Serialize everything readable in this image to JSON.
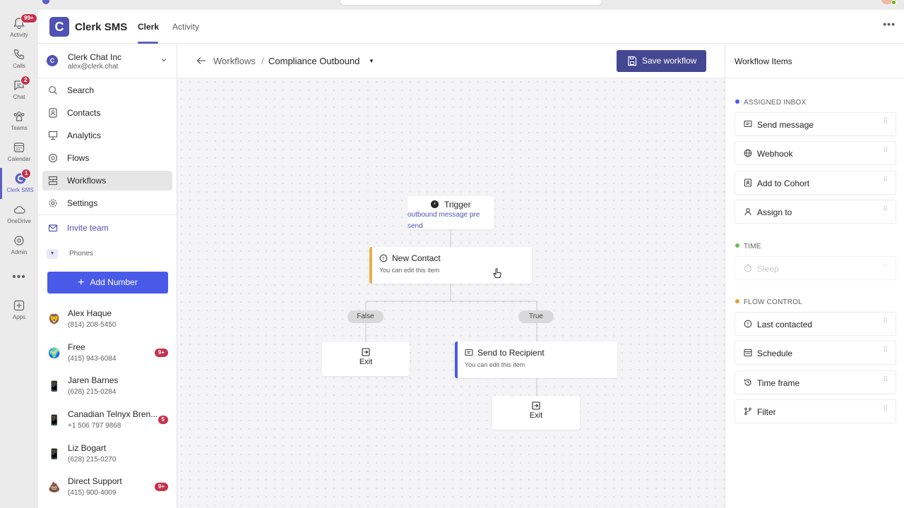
{
  "rail": {
    "items": [
      {
        "label": "Activity",
        "badge": "99+"
      },
      {
        "label": "Calls",
        "badge": ""
      },
      {
        "label": "Chat",
        "badge": "2"
      },
      {
        "label": "Teams",
        "badge": ""
      },
      {
        "label": "Calendar",
        "badge": ""
      },
      {
        "label": "Clerk SMS",
        "badge": "1"
      },
      {
        "label": "OneDrive",
        "badge": ""
      },
      {
        "label": "Admin",
        "badge": ""
      },
      {
        "label": "Apps",
        "badge": ""
      }
    ],
    "more": "•••"
  },
  "header": {
    "app_title": "Clerk SMS",
    "logo_letter": "C",
    "tabs": [
      "Clerk",
      "Activity"
    ],
    "more": "•••"
  },
  "org": {
    "name": "Clerk Chat Inc",
    "email": "alex@clerk.chat",
    "logo_letter": "C"
  },
  "nav": {
    "items": [
      {
        "label": "Search",
        "icon": "search-icon"
      },
      {
        "label": "Contacts",
        "icon": "contacts-icon"
      },
      {
        "label": "Analytics",
        "icon": "analytics-icon"
      },
      {
        "label": "Flows",
        "icon": "flows-icon"
      },
      {
        "label": "Workflows",
        "icon": "workflows-icon"
      },
      {
        "label": "Settings",
        "icon": "gear-icon"
      }
    ],
    "invite": "Invite team"
  },
  "phones": {
    "label": "Phones",
    "add_button": "Add Number",
    "contacts": [
      {
        "name": "Alex Haque",
        "phone": "(814) 208-5450",
        "avatar": "🦁",
        "badge": ""
      },
      {
        "name": "Free",
        "phone": "(415) 943-6084",
        "avatar": "🌍",
        "badge": "9+"
      },
      {
        "name": "Jaren Barnes",
        "phone": "(628) 215-0284",
        "avatar": "📱",
        "badge": ""
      },
      {
        "name": "Canadian Telnyx Bren...",
        "phone": "+1 506 797 9868",
        "avatar": "📱",
        "badge": "5"
      },
      {
        "name": "Liz Bogart",
        "phone": "(628) 215-0270",
        "avatar": "📱",
        "badge": ""
      },
      {
        "name": "Direct Support",
        "phone": "(415) 900-4009",
        "avatar": "💩",
        "badge": "9+"
      }
    ]
  },
  "canvas": {
    "breadcrumb_root": "Workflows",
    "breadcrumb_sep": "/",
    "breadcrumb_current": "Compliance Outbound",
    "save_button": "Save workflow",
    "trigger": {
      "title": "Trigger",
      "subtitle": "outbound message pre send"
    },
    "new_contact": {
      "title": "New Contact",
      "subtitle": "You can edit this item"
    },
    "branch_false": "False",
    "branch_true": "True",
    "exit_label": "Exit",
    "send_recipient": {
      "title": "Send to Recipient",
      "subtitle": "You can edit this item"
    }
  },
  "right_panel": {
    "title": "Workflow Items",
    "sections": [
      {
        "title": "ASSIGNED INBOX",
        "color": "#4a5ae8",
        "items": [
          "Send message",
          "Webhook",
          "Add to Cohort",
          "Assign to"
        ]
      },
      {
        "title": "TIME",
        "color": "#6bbf59",
        "items": [
          "Sleep"
        ]
      },
      {
        "title": "FLOW CONTROL",
        "color": "#e8a33a",
        "items": [
          "Last contacted",
          "Schedule",
          "Time frame",
          "Filter"
        ]
      }
    ]
  },
  "colors": {
    "brand": "#4f52b2",
    "save_button": "#444791",
    "add_number": "#4a5ae8",
    "badge": "#c4314b",
    "new_contact_accent": "#e8b04a",
    "send_recipient_accent": "#4a5ae8"
  }
}
